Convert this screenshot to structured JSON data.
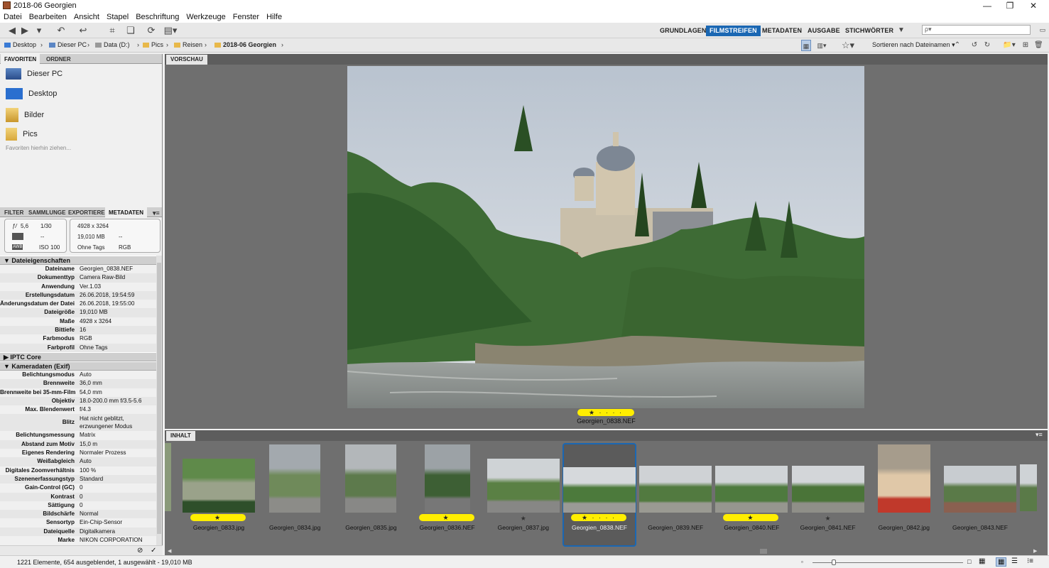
{
  "window": {
    "title": "2018-06 Georgien"
  },
  "menu": [
    "Datei",
    "Bearbeiten",
    "Ansicht",
    "Stapel",
    "Beschriftung",
    "Werkzeuge",
    "Fenster",
    "Hilfe"
  ],
  "workspaces": [
    "GRUNDLAGEN",
    "FILMSTREIFEN",
    "METADATEN",
    "AUSGABE",
    "STICHWÖRTER"
  ],
  "active_workspace": "FILMSTREIFEN",
  "search": {
    "placeholder": "ρ▾"
  },
  "breadcrumb": [
    "Desktop",
    "Dieser PC",
    "Data (D:)",
    "Pics",
    "Reisen",
    "2018-06 Georgien"
  ],
  "sort": {
    "label": "Sortieren nach Dateinamen ▾"
  },
  "left_tabs_top": [
    "FAVORITEN",
    "ORDNER"
  ],
  "favorites": [
    "Dieser PC",
    "Desktop",
    "Bilder",
    "Pics"
  ],
  "favorites_hint": "Favoriten hierhin ziehen...",
  "left_tabs_bottom": [
    "FILTER",
    "SAMMLUNGE",
    "EXPORTIERE",
    "METADATEN"
  ],
  "quick_meta": {
    "aperture": "5,6",
    "shutter": "1/30",
    "iso": "100",
    "dash1": "--",
    "dims": "4928 x 3264",
    "size": "19,010 MB",
    "dash2": "--",
    "tags": "Ohne Tags",
    "mode": "RGB"
  },
  "sections": {
    "file": "Dateieigenschaften",
    "iptc": "IPTC Core",
    "camera": "Kameradaten (Exif)"
  },
  "file_props": [
    [
      "Dateiname",
      "Georgien_0838.NEF"
    ],
    [
      "Dokumenttyp",
      "Camera Raw-Bild"
    ],
    [
      "Anwendung",
      "Ver.1.03"
    ],
    [
      "Erstellungsdatum",
      "26.06.2018, 19:54:59"
    ],
    [
      "Änderungsdatum der Datei",
      "26.06.2018, 19:55:00"
    ],
    [
      "Dateigröße",
      "19,010 MB"
    ],
    [
      "Maße",
      "4928 x 3264"
    ],
    [
      "Bittiefe",
      "16"
    ],
    [
      "Farbmodus",
      "RGB"
    ],
    [
      "Farbprofil",
      "Ohne Tags"
    ]
  ],
  "camera_props": [
    [
      "Belichtungsmodus",
      "Auto"
    ],
    [
      "Brennweite",
      "36,0 mm"
    ],
    [
      "Brennweite bei 35-mm-Film",
      "54,0 mm"
    ],
    [
      "Objektiv",
      "18.0-200.0 mm f/3.5-5.6"
    ],
    [
      "Max. Blendenwert",
      "f/4.3"
    ],
    [
      "Blitz",
      "Hat nicht geblitzt, erzwungener Modus"
    ],
    [
      "Belichtungsmessung",
      "Matrix"
    ],
    [
      "Abstand zum Motiv",
      "15,0 m"
    ],
    [
      "Eigenes Rendering",
      "Normaler Prozess"
    ],
    [
      "Weißabgleich",
      "Auto"
    ],
    [
      "Digitales Zoomverhältnis",
      "100 %"
    ],
    [
      "Szenenerfassungstyp",
      "Standard"
    ],
    [
      "Gain-Control (GC)",
      "0"
    ],
    [
      "Kontrast",
      "0"
    ],
    [
      "Sättigung",
      "0"
    ],
    [
      "Bildschärfe",
      "Normal"
    ],
    [
      "Sensortyp",
      "Ein-Chip-Sensor"
    ],
    [
      "Dateiquelle",
      "Digitalkamera"
    ],
    [
      "Marke",
      "NIKON CORPORATION"
    ]
  ],
  "preview": {
    "tab": "VORSCHAU",
    "filename": "Georgien_0838.NEF",
    "rating": "★ · · · ·"
  },
  "content": {
    "tab": "INHALT",
    "items": [
      {
        "name": "Georgien_0833.jpg",
        "rating": "★",
        "badge": true
      },
      {
        "name": "Georgien_0834.jpg",
        "rating": "",
        "badge": false
      },
      {
        "name": "Georgien_0835.jpg",
        "rating": "",
        "badge": false
      },
      {
        "name": "Georgien_0836.NEF",
        "rating": "★",
        "badge": true
      },
      {
        "name": "Georgien_0837.jpg",
        "rating": "★",
        "badge": false
      },
      {
        "name": "Georgien_0838.NEF",
        "rating": "★ · · · ·",
        "badge": true,
        "selected": true
      },
      {
        "name": "Georgien_0839.NEF",
        "rating": "",
        "badge": false
      },
      {
        "name": "Georgien_0840.NEF",
        "rating": "★",
        "badge": true
      },
      {
        "name": "Georgien_0841.NEF",
        "rating": "★",
        "badge": false
      },
      {
        "name": "Georgien_0842.jpg",
        "rating": "",
        "badge": false
      },
      {
        "name": "Georgien_0843.NEF",
        "rating": "",
        "badge": false
      }
    ]
  },
  "status": "1221 Elemente, 654 ausgeblendet, 1 ausgewählt - 19,010 MB",
  "colors": {
    "accent": "#1a67b3",
    "rating": "#ffee00",
    "panel": "#6f6f6f"
  }
}
